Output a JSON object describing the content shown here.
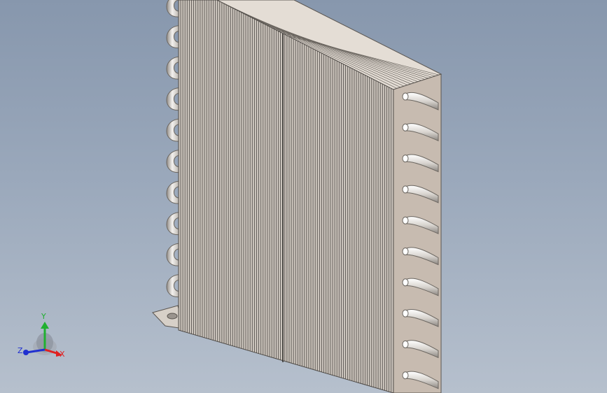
{
  "viewport": {
    "background_top": "#8797ad",
    "background_bottom": "#b6c0cd",
    "model": {
      "name": "condenser-coil",
      "fin_color": "#cbc4bc",
      "fin_line_color": "#4e4a46",
      "tube_plate_color": "#c7bbb0",
      "tube_color": "#e9e6e1"
    }
  },
  "triad": {
    "x_label": "X",
    "y_label": "Y",
    "z_label": "Z",
    "x_color": "#e02020",
    "y_color": "#20b030",
    "z_color": "#2030d0"
  }
}
